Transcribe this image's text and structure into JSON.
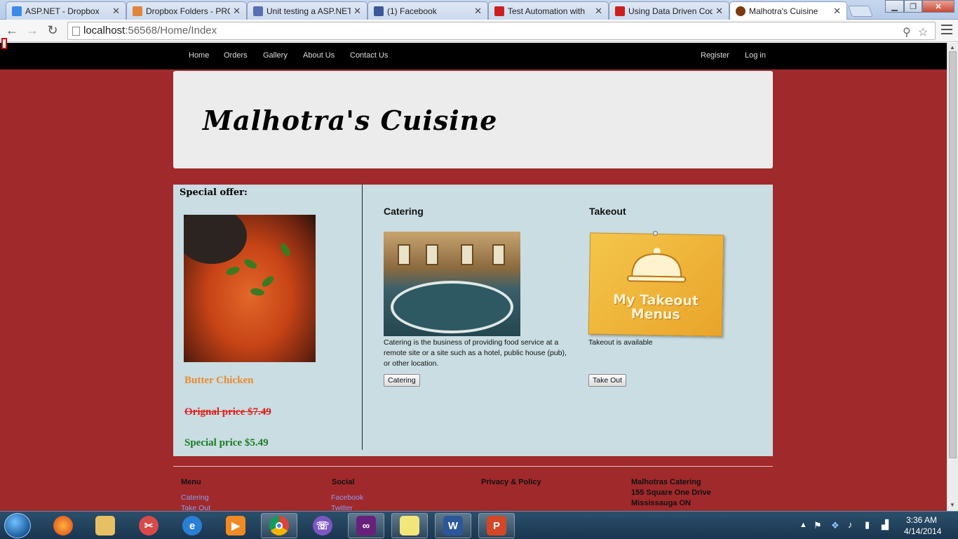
{
  "browser": {
    "tabs": [
      {
        "title": "ASP.NET - Dropbox",
        "icon": "dropbox-icon",
        "color": "#3d8ae6"
      },
      {
        "title": "Dropbox Folders - PRO",
        "icon": "dropbox-folders-icon",
        "color": "#e0853a"
      },
      {
        "title": "Unit testing a ASP.NET",
        "icon": "asp-icon",
        "color": "#5a6fb0"
      },
      {
        "title": "(1) Facebook",
        "icon": "facebook-icon",
        "color": "#3b5998"
      },
      {
        "title": "Test Automation with",
        "icon": "youtube-icon",
        "color": "#cc2020"
      },
      {
        "title": "Using Data Driven Coded",
        "icon": "youtube-icon",
        "color": "#cc2020"
      },
      {
        "title": "Malhotra's Cuisine",
        "icon": "site-icon",
        "color": "#7a3a10"
      }
    ],
    "url_host": "localhost",
    "url_path": ":56568/Home/Index"
  },
  "site": {
    "nav": [
      "Home",
      "Orders",
      "Gallery",
      "About Us",
      "Contact Us"
    ],
    "auth": [
      "Register",
      "Log in"
    ],
    "title": "Malhotra's Cuisine",
    "special_offer": "Special offer:",
    "dish_name": "Butter Chicken",
    "original_price": "Orignal price $7.49",
    "special_price": "Special price $5.49",
    "catering": {
      "heading": "Catering",
      "description": "Catering is the business of providing food service at a remote site or a site such as a hotel, public house (pub), or other location.",
      "button": "Catering"
    },
    "takeout": {
      "heading": "Takeout",
      "image_text": "My Takeout Menus",
      "description": "Takeout is available",
      "button": "Take Out"
    },
    "footer": {
      "menu_heading": "Menu",
      "menu_links": [
        "Catering",
        "Take Out"
      ],
      "social_heading": "Social",
      "social_links": [
        "Facebook",
        "Twitter"
      ],
      "privacy_heading": "Privacy & Policy",
      "address_lines": [
        "Malhotras Catering",
        "155 Square One Drive",
        "Mississauga ON"
      ]
    }
  },
  "taskbar": {
    "apps": [
      "firefox-icon",
      "explorer-icon",
      "snipping-icon",
      "ie-icon",
      "media-player-icon",
      "chrome-icon",
      "viber-icon",
      "visual-studio-icon",
      "sticky-notes-icon",
      "word-icon",
      "powerpoint-icon"
    ],
    "time": "3:36 AM",
    "date": "4/14/2014"
  },
  "colors": {
    "page_bg": "#a0292b",
    "banner_bg": "#ececec",
    "content_bg": "#c9dde2",
    "dish_name": "#ea8a2d",
    "original_price": "#e0201c",
    "special_price": "#1c7a22",
    "footer_link": "#8c9ef0"
  }
}
